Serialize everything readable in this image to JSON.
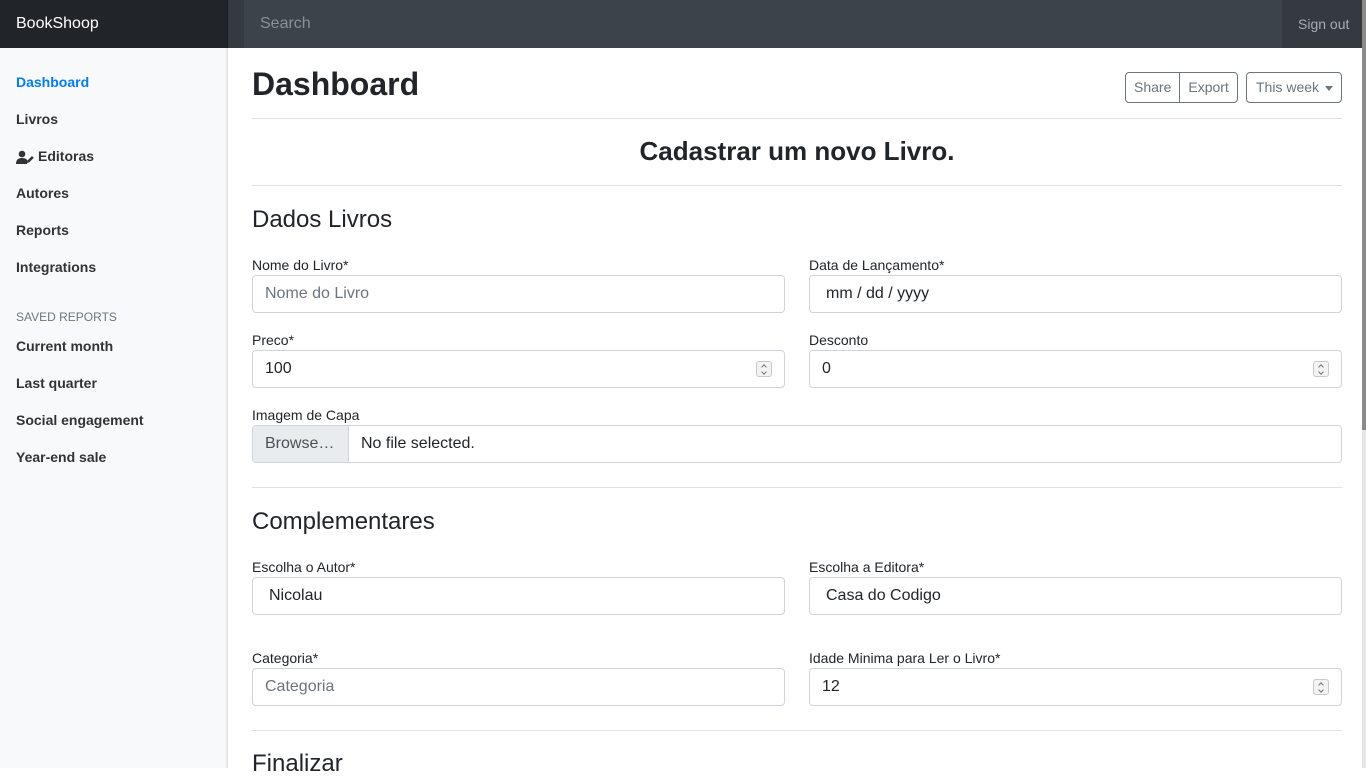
{
  "navbar": {
    "brand": "BookShoop",
    "search_placeholder": "Search",
    "signout": "Sign out"
  },
  "sidebar": {
    "items": [
      {
        "label": "Dashboard",
        "active": true
      },
      {
        "label": "Livros"
      },
      {
        "label": "Editoras",
        "icon": "user-edit-icon"
      },
      {
        "label": "Autores"
      },
      {
        "label": "Reports"
      },
      {
        "label": "Integrations"
      }
    ],
    "saved_heading": "SAVED REPORTS",
    "saved_items": [
      {
        "label": "Current month"
      },
      {
        "label": "Last quarter"
      },
      {
        "label": "Social engagement"
      },
      {
        "label": "Year-end sale"
      }
    ]
  },
  "header": {
    "title": "Dashboard",
    "share": "Share",
    "export": "Export",
    "period": "This week"
  },
  "form": {
    "title": "Cadastrar um novo Livro.",
    "section1": "Dados Livros",
    "nome_label": "Nome do Livro*",
    "nome_placeholder": "Nome do Livro",
    "data_label": "Data de Lançamento*",
    "data_placeholder": "mm / dd / yyyy",
    "preco_label": "Preco*",
    "preco_value": "100",
    "desconto_label": "Desconto",
    "desconto_value": "0",
    "imagem_label": "Imagem de Capa",
    "browse": "Browse…",
    "file_status": "No file selected.",
    "section2": "Complementares",
    "autor_label": "Escolha o Autor*",
    "autor_value": "Nicolau",
    "editora_label": "Escolha a Editora*",
    "editora_value": "Casa do Codigo",
    "categoria_label": "Categoria*",
    "categoria_placeholder": "Categoria",
    "idade_label": "Idade Minima para Ler o Livro*",
    "idade_value": "12",
    "section3": "Finalizar"
  },
  "colors": {
    "navbar": "#343a40",
    "brand_bg": "#212529",
    "active_link": "#007bff",
    "sidebar_bg": "#f8f9fa"
  }
}
